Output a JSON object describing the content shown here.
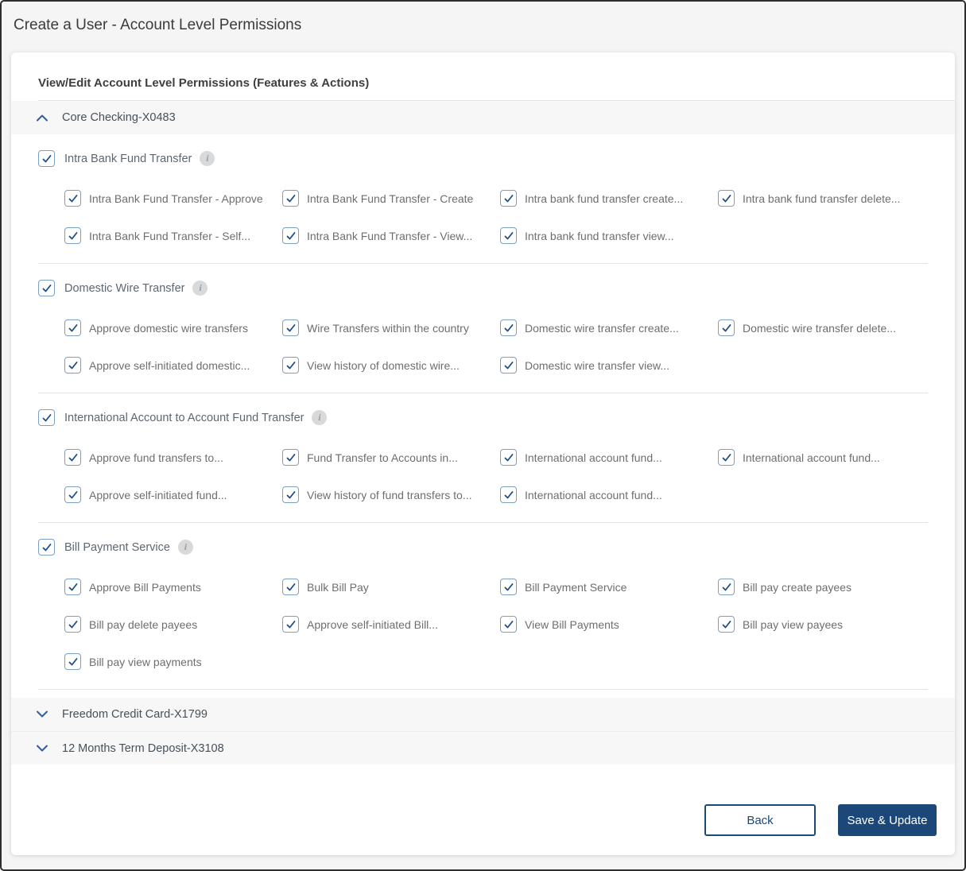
{
  "page": {
    "title": "Create a User - Account Level Permissions"
  },
  "card": {
    "title": "View/Edit Account Level Permissions (Features & Actions)"
  },
  "accounts": [
    {
      "label": "Core Checking-X0483",
      "expanded": true,
      "groups": [
        {
          "label": "Intra Bank Fund Transfer",
          "checked": true,
          "permissions": [
            {
              "label": "Intra Bank Fund Transfer - Approve",
              "checked": true
            },
            {
              "label": "Intra Bank Fund Transfer - Create",
              "checked": true
            },
            {
              "label": "Intra bank fund transfer create...",
              "checked": true
            },
            {
              "label": "Intra bank fund transfer delete...",
              "checked": true
            },
            {
              "label": "Intra Bank Fund Transfer - Self...",
              "checked": true
            },
            {
              "label": "Intra Bank Fund Transfer - View...",
              "checked": true
            },
            {
              "label": "Intra bank fund transfer view...",
              "checked": true
            }
          ]
        },
        {
          "label": "Domestic Wire Transfer",
          "checked": true,
          "permissions": [
            {
              "label": "Approve domestic wire transfers",
              "checked": true
            },
            {
              "label": "Wire Transfers within the country",
              "checked": true
            },
            {
              "label": "Domestic wire transfer create...",
              "checked": true
            },
            {
              "label": "Domestic wire transfer delete...",
              "checked": true
            },
            {
              "label": "Approve self-initiated domestic...",
              "checked": true
            },
            {
              "label": "View history of domestic wire...",
              "checked": true
            },
            {
              "label": "Domestic wire transfer view...",
              "checked": true
            }
          ]
        },
        {
          "label": "International Account to Account Fund Transfer",
          "checked": true,
          "permissions": [
            {
              "label": "Approve fund transfers to...",
              "checked": true
            },
            {
              "label": "Fund Transfer to Accounts in...",
              "checked": true
            },
            {
              "label": "International account fund...",
              "checked": true
            },
            {
              "label": "International account fund...",
              "checked": true
            },
            {
              "label": "Approve self-initiated fund...",
              "checked": true
            },
            {
              "label": "View history of fund transfers to...",
              "checked": true
            },
            {
              "label": "International account fund...",
              "checked": true
            }
          ]
        },
        {
          "label": "Bill Payment Service",
          "checked": true,
          "permissions": [
            {
              "label": "Approve Bill Payments",
              "checked": true
            },
            {
              "label": "Bulk Bill Pay",
              "checked": true
            },
            {
              "label": "Bill Payment Service",
              "checked": true
            },
            {
              "label": "Bill pay create payees",
              "checked": true
            },
            {
              "label": "Bill pay delete payees",
              "checked": true
            },
            {
              "label": "Approve self-initiated Bill...",
              "checked": true
            },
            {
              "label": "View Bill Payments",
              "checked": true
            },
            {
              "label": "Bill pay view payees",
              "checked": true
            },
            {
              "label": "Bill pay view payments",
              "checked": true
            }
          ]
        }
      ]
    },
    {
      "label": "Freedom Credit Card-X1799",
      "expanded": false
    },
    {
      "label": "12 Months Term Deposit-X3108",
      "expanded": false
    }
  ],
  "footer": {
    "back_label": "Back",
    "save_label": "Save & Update"
  },
  "icons": {
    "info": "i",
    "check": "✓",
    "chevron_up": "⌃",
    "chevron_down": "⌄"
  },
  "colors": {
    "accent_navy": "#1B4779",
    "check_mark": "#1D4E89",
    "checkbox_border": "#7BA0C6",
    "chevron_blue": "#2F5F9E",
    "accordion_bg": "#F7F7F8",
    "page_bg": "#F5F5F5",
    "divider": "#E3E3E3",
    "label_gray": "#6E6E6E"
  }
}
